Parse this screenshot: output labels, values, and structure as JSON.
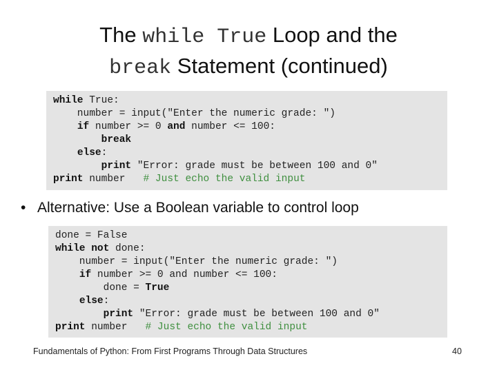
{
  "slide": {
    "title": {
      "part1": "The ",
      "code1": "while True",
      "part2": " Loop and the",
      "code2": "break",
      "part3": " Statement (continued)"
    },
    "code_block_1": {
      "lines": [
        [
          {
            "t": "while",
            "s": "kw"
          },
          {
            "t": " True:",
            "s": ""
          }
        ],
        [
          {
            "t": "    number = input(\"Enter the numeric grade: \")",
            "s": ""
          }
        ],
        [
          {
            "t": "    ",
            "s": ""
          },
          {
            "t": "if",
            "s": "kw"
          },
          {
            "t": " number >= 0 ",
            "s": ""
          },
          {
            "t": "and",
            "s": "kw"
          },
          {
            "t": " number <= 100:",
            "s": ""
          }
        ],
        [
          {
            "t": "        ",
            "s": ""
          },
          {
            "t": "break",
            "s": "kw"
          }
        ],
        [
          {
            "t": "    ",
            "s": ""
          },
          {
            "t": "else",
            "s": "kw"
          },
          {
            "t": ":",
            "s": ""
          }
        ],
        [
          {
            "t": "        ",
            "s": ""
          },
          {
            "t": "print",
            "s": "kw"
          },
          {
            "t": " \"Error: grade must be between 100 and 0\"",
            "s": ""
          }
        ],
        [
          {
            "t": "print",
            "s": "kw"
          },
          {
            "t": " number   ",
            "s": ""
          },
          {
            "t": "# Just echo the valid input",
            "s": "cm"
          }
        ]
      ]
    },
    "bullet": {
      "symbol": "•",
      "text": "Alternative: Use a Boolean variable to control loop"
    },
    "code_block_2": {
      "lines": [
        [
          {
            "t": "done = False",
            "s": ""
          }
        ],
        [
          {
            "t": "while",
            "s": "kw"
          },
          {
            "t": " ",
            "s": ""
          },
          {
            "t": "not",
            "s": "kw"
          },
          {
            "t": " done:",
            "s": ""
          }
        ],
        [
          {
            "t": "    number = input(\"Enter the numeric grade: \")",
            "s": ""
          }
        ],
        [
          {
            "t": "    ",
            "s": ""
          },
          {
            "t": "if",
            "s": "kw"
          },
          {
            "t": " number >= 0 and number <= 100:",
            "s": ""
          }
        ],
        [
          {
            "t": "        done = ",
            "s": ""
          },
          {
            "t": "True",
            "s": "kw"
          }
        ],
        [
          {
            "t": "    ",
            "s": ""
          },
          {
            "t": "else",
            "s": "kw"
          },
          {
            "t": ":",
            "s": ""
          }
        ],
        [
          {
            "t": "        ",
            "s": ""
          },
          {
            "t": "print",
            "s": "kw"
          },
          {
            "t": " \"Error: grade must be between 100 and 0\"",
            "s": ""
          }
        ],
        [
          {
            "t": "print",
            "s": "kw"
          },
          {
            "t": " number   ",
            "s": ""
          },
          {
            "t": "# Just echo the valid input",
            "s": "cm"
          }
        ]
      ]
    },
    "footer": {
      "book_title": "Fundamentals of Python: From First Programs Through Data Structures",
      "page_number": "40"
    },
    "colors": {
      "code_background": "#e4e4e4",
      "comment": "#3f8f3f"
    }
  }
}
